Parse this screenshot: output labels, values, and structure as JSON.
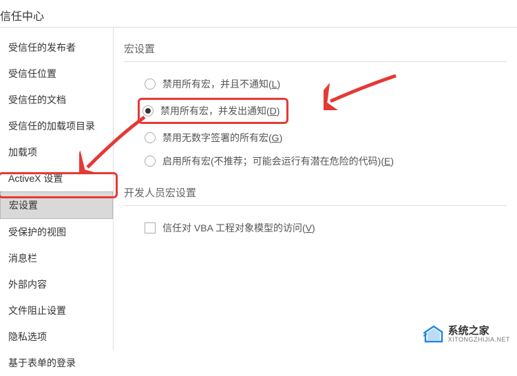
{
  "header": {
    "title": "信任中心"
  },
  "sidebar": {
    "items": [
      {
        "label": "受信任的发布者"
      },
      {
        "label": "受信任位置"
      },
      {
        "label": "受信任的文档"
      },
      {
        "label": "受信任的加载项目录"
      },
      {
        "label": "加载项"
      },
      {
        "label": "ActiveX 设置"
      },
      {
        "label": "宏设置"
      },
      {
        "label": "受保护的视图"
      },
      {
        "label": "消息栏"
      },
      {
        "label": "外部内容"
      },
      {
        "label": "文件阻止设置"
      },
      {
        "label": "隐私选项"
      },
      {
        "label": "基于表单的登录"
      }
    ],
    "selected_index": 6
  },
  "content": {
    "macro_section_title": "宏设置",
    "macro_options": [
      {
        "label": "禁用所有宏，并且不通知(",
        "accel": "L",
        "tail": ")",
        "checked": false
      },
      {
        "label": "禁用所有宏，并发出通知(",
        "accel": "D",
        "tail": ")",
        "checked": true
      },
      {
        "label": "禁用无数字签署的所有宏(",
        "accel": "G",
        "tail": ")",
        "checked": false
      },
      {
        "label": "启用所有宏(不推荐；可能会运行有潜在危险的代码)(",
        "accel": "E",
        "tail": ")",
        "checked": false
      }
    ],
    "dev_section_title": "开发人员宏设置",
    "dev_checkbox": {
      "label": "信任对 VBA 工程对象模型的访问(",
      "accel": "V",
      "tail": ")",
      "checked": false
    }
  },
  "watermark": {
    "cn": "系统之家",
    "en": "XITONGZHIJIA.NET"
  }
}
